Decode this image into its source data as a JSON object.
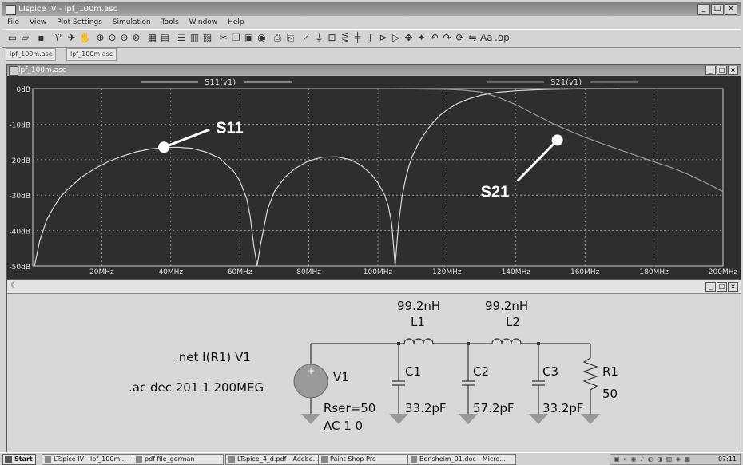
{
  "app": {
    "title": "LTspice IV - lpf_100m.asc",
    "window_buttons": [
      "_",
      "□",
      "×"
    ]
  },
  "menu": [
    "File",
    "View",
    "Plot Settings",
    "Simulation",
    "Tools",
    "Window",
    "Help"
  ],
  "tabs": [
    {
      "label": "lpf_100m.asc"
    },
    {
      "label": "lpf_100m.asc"
    }
  ],
  "plot_window": {
    "title": "lpf_100m.asc",
    "buttons": [
      "_",
      "□",
      "×"
    ]
  },
  "schematic_window": {
    "buttons": [
      "_",
      "□",
      "×"
    ]
  },
  "chart_data": {
    "type": "line",
    "xlim": [
      0,
      200
    ],
    "x_unit": "MHz",
    "ylim": [
      -50,
      0
    ],
    "y_unit": "dB",
    "xtick_labels": [
      "20MHz",
      "40MHz",
      "60MHz",
      "80MHz",
      "100MHz",
      "120MHz",
      "140MHz",
      "160MHz",
      "180MHz",
      "200MHz"
    ],
    "ytick_labels": [
      "0dB",
      "-10dB",
      "-20dB",
      "-30dB",
      "-40dB",
      "-50dB"
    ],
    "grid": true,
    "series": [
      {
        "name": "S11(v1)",
        "x": [
          0.5,
          2,
          4,
          6,
          8,
          10,
          14,
          18,
          22,
          26,
          30,
          34,
          38,
          42,
          46,
          50,
          54,
          58,
          60,
          62,
          63,
          64,
          65,
          66,
          68,
          70,
          73,
          76,
          80,
          84,
          88,
          92,
          95,
          98,
          100,
          102,
          103,
          104,
          105,
          106,
          107,
          108,
          109,
          110,
          112,
          114,
          116,
          118,
          120,
          123,
          126,
          130,
          135,
          140,
          145,
          150,
          155,
          160,
          165,
          170
        ],
        "y": [
          -50,
          -43,
          -37,
          -33.5,
          -30.5,
          -28.5,
          -25,
          -22.5,
          -20.5,
          -19,
          -17.8,
          -17,
          -16.6,
          -16.5,
          -16.8,
          -17.8,
          -19.5,
          -23,
          -26,
          -31,
          -36,
          -44,
          -50,
          -44,
          -34,
          -29,
          -25,
          -22.5,
          -20.3,
          -19.3,
          -19.2,
          -20,
          -21.5,
          -24,
          -26.5,
          -30,
          -33,
          -38,
          -50,
          -38,
          -30.5,
          -25.5,
          -21.8,
          -19,
          -15,
          -12,
          -9.5,
          -7.5,
          -6,
          -4.2,
          -3,
          -1.8,
          -1,
          -0.6,
          -0.35,
          -0.2,
          -0.12,
          -0.06,
          -0.02,
          0
        ],
        "color": "#d8d8d8"
      },
      {
        "name": "S21(v1)",
        "x": [
          0,
          20,
          40,
          60,
          80,
          100,
          110,
          120,
          125,
          130,
          135,
          140,
          145,
          150,
          155,
          160,
          165,
          170,
          175,
          180,
          185,
          190,
          195,
          200
        ],
        "y": [
          0,
          0,
          0,
          0,
          0,
          0,
          -0.1,
          -0.2,
          -0.45,
          -1,
          -2.5,
          -4.5,
          -7,
          -9.5,
          -11.7,
          -13.7,
          -15.5,
          -17.2,
          -18.9,
          -20.6,
          -22.2,
          -24.2,
          -26.5,
          -29
        ],
        "color": "#9a9a9a"
      }
    ],
    "annotations": [
      {
        "text": "S11",
        "x": 38,
        "y": -16.5
      },
      {
        "text": "S21",
        "x": 152,
        "y": -14.5
      }
    ]
  },
  "schematic": {
    "directive_net": ".net I(R1) V1",
    "directive_ac": ".ac dec 201 1 200MEG",
    "v1_name": "V1",
    "v1_rser": "Rser=50",
    "v1_ac": "AC 1 0",
    "l1_value": "99.2nH",
    "l1_name": "L1",
    "l2_value": "99.2nH",
    "l2_name": "L2",
    "c1_name": "C1",
    "c1_value": "33.2pF",
    "c2_name": "C2",
    "c2_value": "57.2pF",
    "c3_name": "C3",
    "c3_value": "33.2pF",
    "r1_name": "R1",
    "r1_value": "50"
  },
  "taskbar": {
    "start": "Start",
    "items": [
      "LTspice IV - lpf_100m...",
      "pdf-file_german",
      "LTspice_4_d.pdf - Adobe...",
      "Paint Shop Pro",
      "Bensheim_01.doc - Micro..."
    ],
    "clock": "07:11"
  }
}
